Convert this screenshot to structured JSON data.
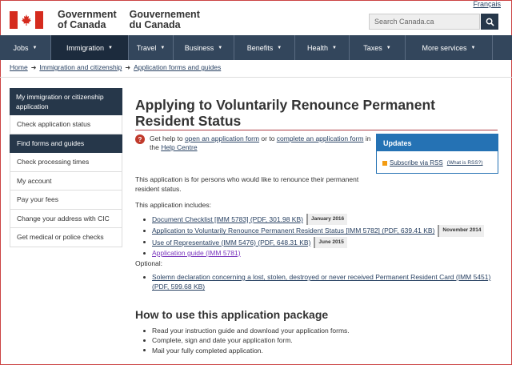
{
  "header": {
    "language_link": "Français",
    "gov_name_en_line1": "Government",
    "gov_name_en_line2": "of Canada",
    "gov_name_fr_line1": "Gouvernement",
    "gov_name_fr_line2": "du Canada",
    "search_placeholder": "Search Canada.ca",
    "flag_icon": "canada-flag-icon",
    "search_icon": "search-icon"
  },
  "menu": [
    {
      "label": "Jobs"
    },
    {
      "label": "Immigration"
    },
    {
      "label": "Travel"
    },
    {
      "label": "Business"
    },
    {
      "label": "Benefits"
    },
    {
      "label": "Health"
    },
    {
      "label": "Taxes"
    },
    {
      "label": "More services"
    }
  ],
  "breadcrumb": [
    "Home",
    "Immigration and citizenship",
    "Application forms and guides"
  ],
  "sidebar": {
    "heading": "My immigration or citizenship application",
    "items": [
      "Check application status",
      "Find forms and guides",
      "Check processing times",
      "My account",
      "Pay your fees",
      "Change your address with CIC",
      "Get medical or police checks"
    ]
  },
  "main": {
    "title": "Applying to Voluntarily Renounce Permanent Resident Status",
    "help": {
      "prefix": "Get help to ",
      "link1": "open an application form",
      "middle": " or to ",
      "link2": "complete an application form",
      "suffix": " in the ",
      "link3": "Help Centre"
    },
    "updates": {
      "heading": "Updates",
      "rss_link": "Subscribe via RSS",
      "what_link": "(What is RSS?)"
    },
    "intro": "This application is for persons who would like to renounce their permanent resident status.",
    "includes_label": "This application includes:",
    "includes": [
      {
        "text": "Document Checklist [IMM 5783] (PDF, 301.98 KB)",
        "date": "January 2016"
      },
      {
        "text": "Application to Voluntarily Renounce Permanent Resident Status  [IMM 5782] (PDF, 639.41 KB)",
        "date": "November 2014"
      },
      {
        "text": "Use of Representative (IMM 5476) (PDF, 648.31 KB)",
        "date": "June 2015"
      },
      {
        "text": "Application guide (IMM 5781)",
        "date": ""
      }
    ],
    "optional_label": "Optional:",
    "optional_line1": "Solemn declaration concerning a lost, stolen, destroyed or never received Permanent Resident Card (IMM 5451)",
    "optional_line2": "(PDF, 599.68 KB)",
    "how_to_heading": "How to use this application package",
    "steps": [
      "Read your instruction guide and download your application forms.",
      "Complete, sign and date your application form.",
      "Mail your fully completed application."
    ]
  }
}
